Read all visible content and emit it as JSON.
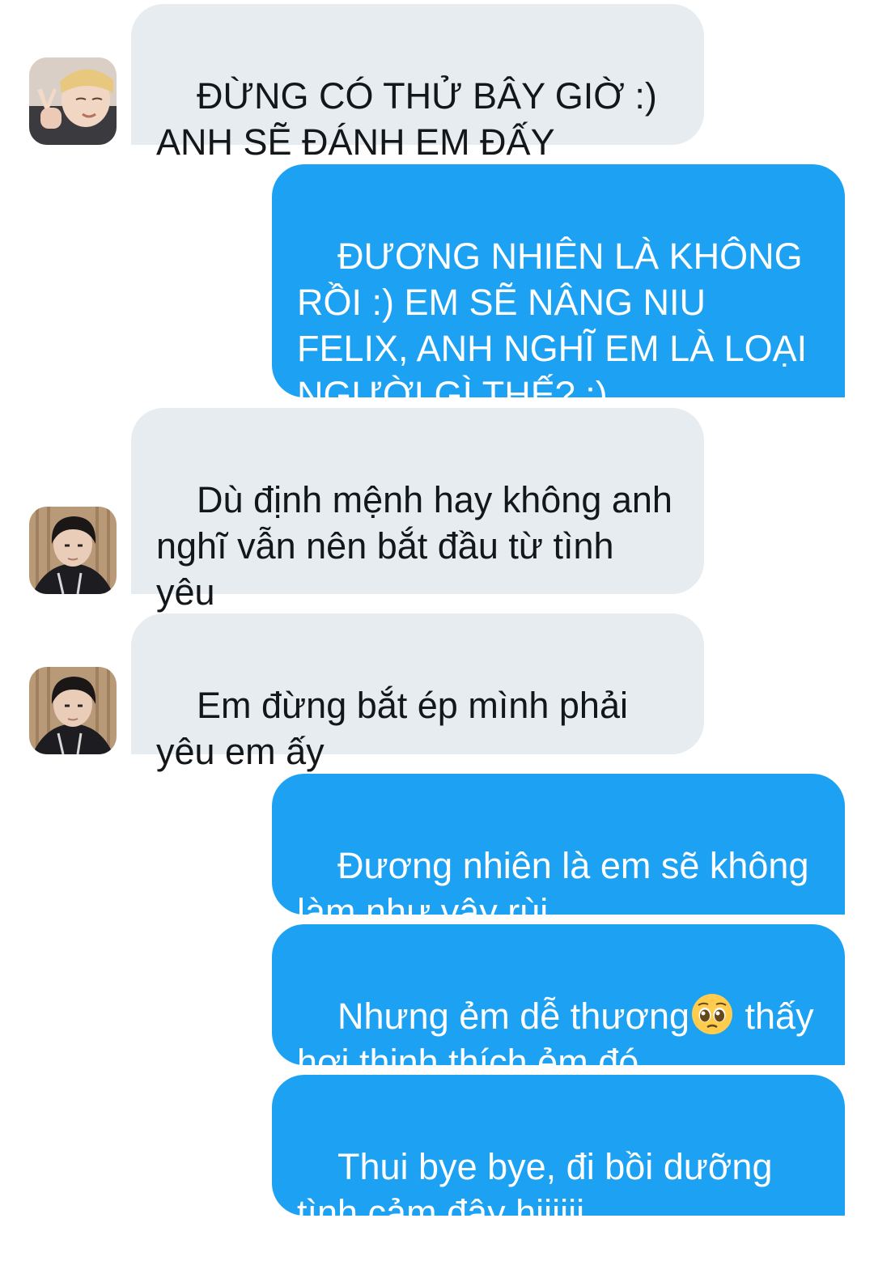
{
  "messages": [
    {
      "side": "in",
      "text": "ĐỪNG CÓ THỬ BÂY GIỜ :)\nANH SẼ ĐÁNH EM ĐẤY"
    },
    {
      "side": "out",
      "text": "ĐƯƠNG NHIÊN LÀ KHÔNG\nRỒI :) EM SẼ NÂNG NIU\nFELIX, ANH NGHĨ EM LÀ LOẠI\nNGƯỜI GÌ THẾ? :)"
    },
    {
      "side": "in",
      "text": "Dù định mệnh hay không anh\nnghĩ vẫn nên bắt đầu từ tình\nyêu"
    },
    {
      "side": "in",
      "text": "Em đừng bắt ép mình phải\nyêu em ấy"
    },
    {
      "side": "out",
      "text": "Đương nhiên là em sẽ không\nlàm như vậy rùi"
    },
    {
      "side": "out",
      "text_before": "Nhưng ẻm dễ thương",
      "emoji": "pleading-face-icon",
      "text_after": " thấy\nhơi thinh thích ẻm đó"
    },
    {
      "side": "out",
      "text": "Thui bye bye, đi bồi dưỡng\ntình cảm đây hiiiiii"
    }
  ],
  "colors": {
    "incoming_bubble": "#e6ecf0",
    "incoming_text": "#14171a",
    "outgoing_bubble": "#1da1f2",
    "outgoing_text": "#ffffff"
  },
  "avatars": [
    "avatar-peace-sign",
    "avatar-dark-jacket",
    "avatar-dark-jacket"
  ]
}
